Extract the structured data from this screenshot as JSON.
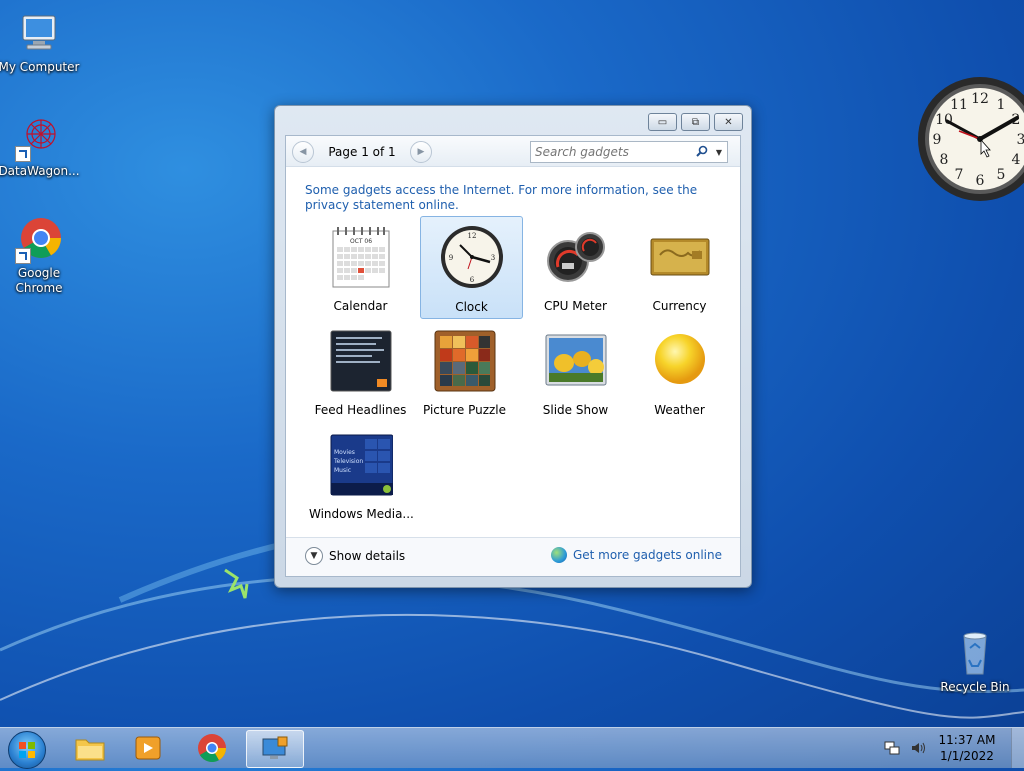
{
  "desktop": {
    "icons": [
      {
        "label": "My Computer"
      },
      {
        "label": "DataWagon..."
      },
      {
        "label": "Google Chrome"
      },
      {
        "label": "Recycle Bin"
      }
    ]
  },
  "gadget_window": {
    "controls": {
      "minimize": "▭",
      "restore": "⧉",
      "close": "✕"
    },
    "pager": {
      "prev": "◀",
      "next": "▶",
      "text": "Page 1 of 1"
    },
    "search": {
      "placeholder": "Search gadgets"
    },
    "info_text": "Some gadgets access the Internet.  For more information, see the privacy statement online.",
    "gadgets": [
      {
        "label": "Calendar"
      },
      {
        "label": "Clock",
        "selected": true
      },
      {
        "label": "CPU Meter"
      },
      {
        "label": "Currency"
      },
      {
        "label": "Feed Headlines"
      },
      {
        "label": "Picture Puzzle"
      },
      {
        "label": "Slide Show"
      },
      {
        "label": "Weather"
      },
      {
        "label": "Windows Media..."
      }
    ],
    "calendar_month": "OCT 06",
    "media_thumb_lines": [
      "Movies",
      "Television",
      "Music"
    ],
    "footer": {
      "show_details": "Show details",
      "get_more": "Get more gadgets online"
    }
  },
  "taskbar": {
    "time": "11:37 AM",
    "date": "1/1/2022"
  },
  "colors": {
    "link": "#1f5fae",
    "selection": "#c9e1f8",
    "desktop": "#1a69c8"
  }
}
